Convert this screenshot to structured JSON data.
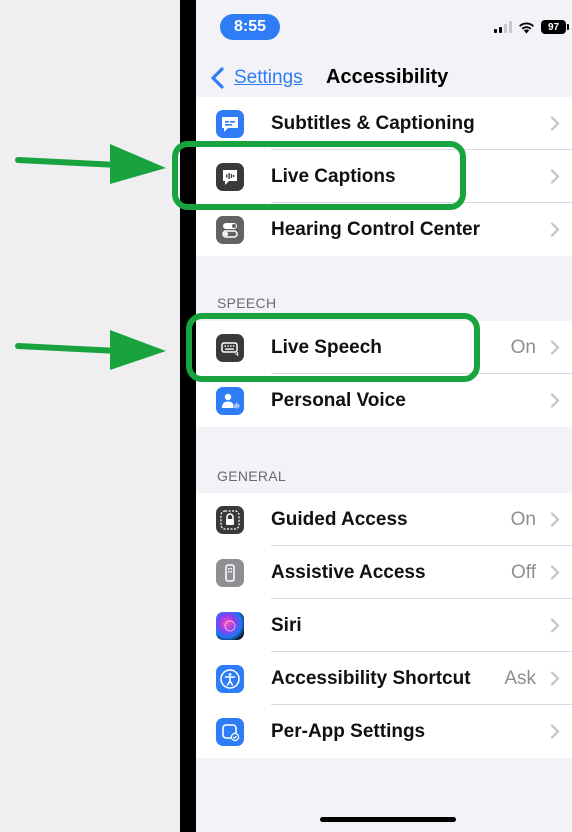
{
  "status_bar": {
    "time": "8:55",
    "battery": "97"
  },
  "nav": {
    "back_label": "Settings",
    "title": "Accessibility"
  },
  "colors": {
    "accent": "#2f7df6",
    "highlight": "#19a33f",
    "arrow": "#19a33f"
  },
  "groups": {
    "hearing": {
      "items": [
        {
          "label": "Subtitles & Captioning",
          "value": "",
          "icon": "subtitles-icon"
        },
        {
          "label": "Live Captions",
          "value": "",
          "icon": "live-captions-icon"
        },
        {
          "label": "Hearing Control Center",
          "value": "",
          "icon": "toggles-icon"
        }
      ]
    },
    "speech": {
      "header": "SPEECH",
      "items": [
        {
          "label": "Live Speech",
          "value": "On",
          "icon": "keyboard-icon"
        },
        {
          "label": "Personal Voice",
          "value": "",
          "icon": "personal-voice-icon"
        }
      ]
    },
    "general": {
      "header": "GENERAL",
      "items": [
        {
          "label": "Guided Access",
          "value": "On",
          "icon": "lock-icon"
        },
        {
          "label": "Assistive Access",
          "value": "Off",
          "icon": "remote-icon"
        },
        {
          "label": "Siri",
          "value": "",
          "icon": "siri-icon"
        },
        {
          "label": "Accessibility Shortcut",
          "value": "Ask",
          "icon": "accessibility-icon"
        },
        {
          "label": "Per-App Settings",
          "value": "",
          "icon": "app-settings-icon"
        }
      ]
    }
  }
}
